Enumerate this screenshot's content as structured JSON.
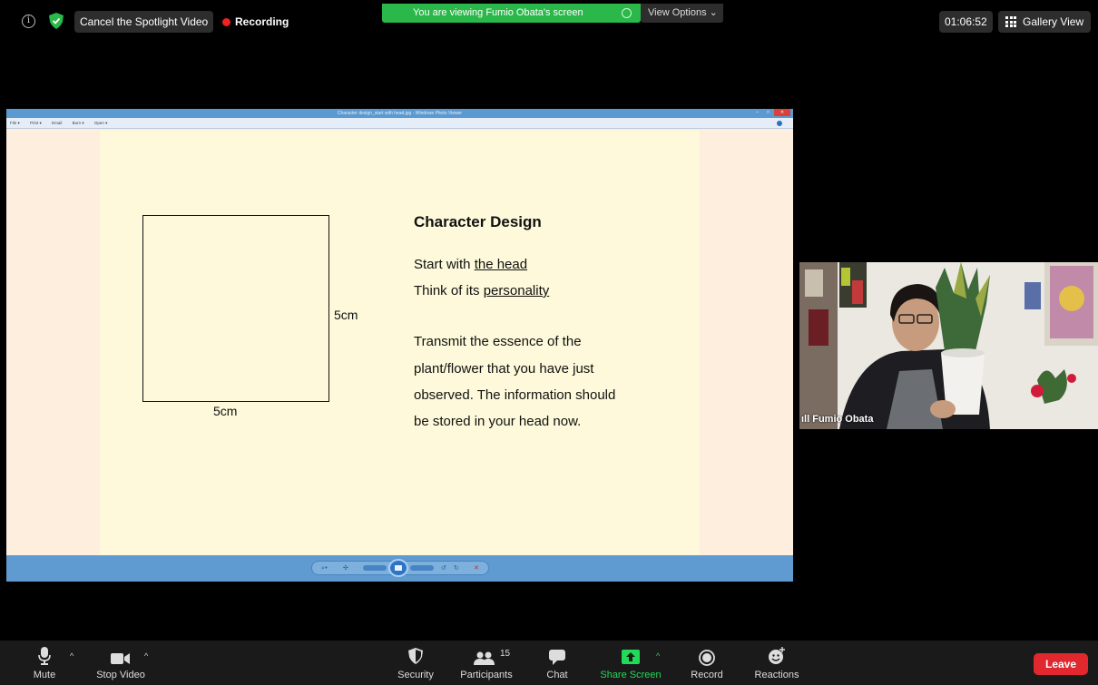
{
  "top_bar": {
    "spotlight_label": "Cancel the Spotlight Video",
    "recording_label": "Recording",
    "viewing_banner": "You are viewing Fumio Obata's screen",
    "view_options": "View Options ⌄",
    "timer": "01:06:52",
    "gallery_view": "Gallery View"
  },
  "photo_viewer": {
    "window_title": "Character design_start with head.jpg - Windows Photo Viewer",
    "menu": [
      "File ▾",
      "Print ▾",
      "Email",
      "Burn ▾",
      "Open ▾"
    ]
  },
  "slide": {
    "title": "Character Design",
    "line1_prefix": "Start with ",
    "line1_link": "the head",
    "line2_prefix": "Think of its ",
    "line2_link": "personality",
    "body": [
      "Transmit the essence of the",
      "plant/flower that you have just",
      "observed. The information should",
      "be stored in your head now."
    ],
    "square_label_right": "5cm",
    "square_label_bottom": "5cm"
  },
  "participant": {
    "name": "Fumio Obata"
  },
  "toolbar": {
    "mute": "Mute",
    "stop_video": "Stop Video",
    "security": "Security",
    "participants": "Participants",
    "participants_count": "15",
    "chat": "Chat",
    "share_screen": "Share Screen",
    "record": "Record",
    "reactions": "Reactions",
    "leave": "Leave"
  },
  "colors": {
    "recording_red": "#e22222",
    "banner_green": "#2ab84a",
    "share_green": "#23d959",
    "leave_red": "#e0282e"
  }
}
